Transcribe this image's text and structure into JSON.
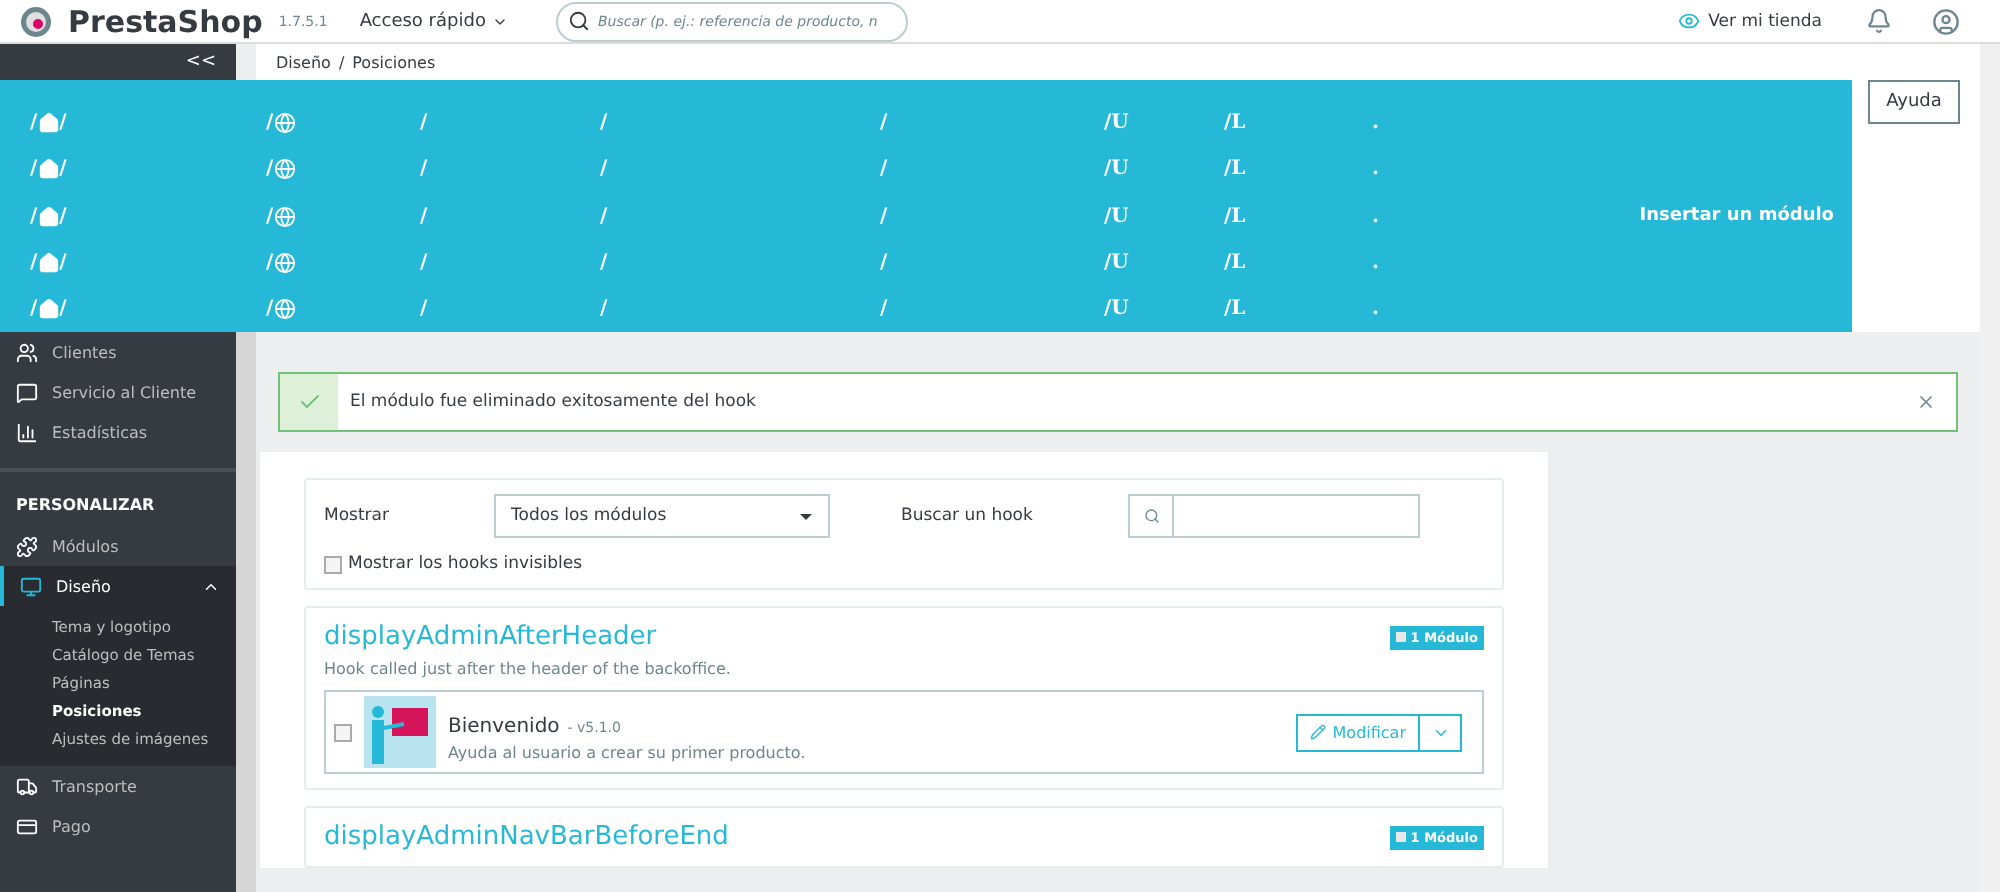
{
  "header": {
    "logo": "PrestaShop",
    "version": "1.7.5.1",
    "quick_access": "Acceso rápido",
    "search": {
      "placeholder": "Buscar (p. ej.: referencia de producto, n"
    },
    "view_store": "Ver mi tienda"
  },
  "sidebar": {
    "collapse": "<<",
    "items": [
      {
        "kind": "item",
        "label": "Clientes"
      },
      {
        "kind": "item",
        "label": "Servicio al Cliente"
      },
      {
        "kind": "item",
        "label": "Estadísticas"
      },
      {
        "kind": "section",
        "label": "PERSONALIZAR"
      },
      {
        "kind": "item",
        "label": "Módulos"
      },
      {
        "kind": "item",
        "label": "Diseño",
        "selected": true,
        "expanded": true,
        "children": [
          {
            "label": "Tema y logotipo",
            "selected": false
          },
          {
            "label": "Catálogo de Temas",
            "selected": false
          },
          {
            "label": "Páginas",
            "selected": false
          },
          {
            "label": "Posiciones",
            "selected": true
          },
          {
            "label": "Ajustes de imágenes",
            "selected": false
          }
        ]
      },
      {
        "kind": "item",
        "label": "Transporte"
      },
      {
        "kind": "item",
        "label": "Pago"
      }
    ]
  },
  "breadcrumb": {
    "items": [
      "Diseño",
      "Posiciones"
    ],
    "separator": "/"
  },
  "toolbar": {
    "help": "Ayuda"
  },
  "overlay": {
    "action": "Insertar un módulo",
    "rows": [
      {
        "cells": [
          {
            "kind": "home",
            "text": "/",
            "after": "/"
          },
          {
            "kind": "globe",
            "text": "/"
          },
          {
            "text": "/"
          },
          {
            "text": "/"
          },
          {
            "text": "/"
          },
          {
            "text": "/U"
          },
          {
            "text": "/L"
          },
          {
            "text": "."
          }
        ]
      },
      {
        "cells": [
          {
            "kind": "home",
            "text": "/",
            "after": "/"
          },
          {
            "kind": "globe",
            "text": "/"
          },
          {
            "text": "/"
          },
          {
            "text": "/"
          },
          {
            "text": "/"
          },
          {
            "text": "/U"
          },
          {
            "text": "/L"
          },
          {
            "text": "."
          }
        ]
      },
      {
        "cells": [
          {
            "kind": "home",
            "text": "/",
            "after": "/"
          },
          {
            "kind": "globe",
            "text": "/"
          },
          {
            "text": "/"
          },
          {
            "text": "/"
          },
          {
            "text": "/"
          },
          {
            "text": "/U"
          },
          {
            "text": "/L"
          },
          {
            "text": "."
          }
        ]
      },
      {
        "cells": [
          {
            "kind": "home",
            "text": "/",
            "after": "/"
          },
          {
            "kind": "globe",
            "text": "/"
          },
          {
            "text": "/"
          },
          {
            "text": "/"
          },
          {
            "text": "/"
          },
          {
            "text": "/U"
          },
          {
            "text": "/L"
          },
          {
            "text": "."
          }
        ]
      },
      {
        "cells": [
          {
            "kind": "home",
            "text": "/",
            "after": "/"
          },
          {
            "kind": "globe",
            "text": "/"
          },
          {
            "text": "/"
          },
          {
            "text": "/"
          },
          {
            "text": "/"
          },
          {
            "text": "/U"
          },
          {
            "text": "/L"
          },
          {
            "text": "."
          }
        ]
      }
    ]
  },
  "alert": {
    "message": "El módulo fue eliminado exitosamente del hook"
  },
  "filters": {
    "show_label": "Mostrar",
    "show_value": "Todos los módulos",
    "search_label": "Buscar un hook",
    "invisible_hooks": {
      "label": "Mostrar los hooks invisibles",
      "checked": false
    }
  },
  "hooks": [
    {
      "name": "displayAdminAfterHeader",
      "count": "1 Módulo",
      "description": "Hook called just after the header of the backoffice.",
      "modules": [
        {
          "name": "Bienvenido",
          "version": "- v5.1.0",
          "description": "Ayuda al usuario a crear su primer producto.",
          "checked": false,
          "action": "Modificar"
        }
      ]
    },
    {
      "name": "displayAdminNavBarBeforeEnd",
      "count": "1 Módulo"
    }
  ]
}
